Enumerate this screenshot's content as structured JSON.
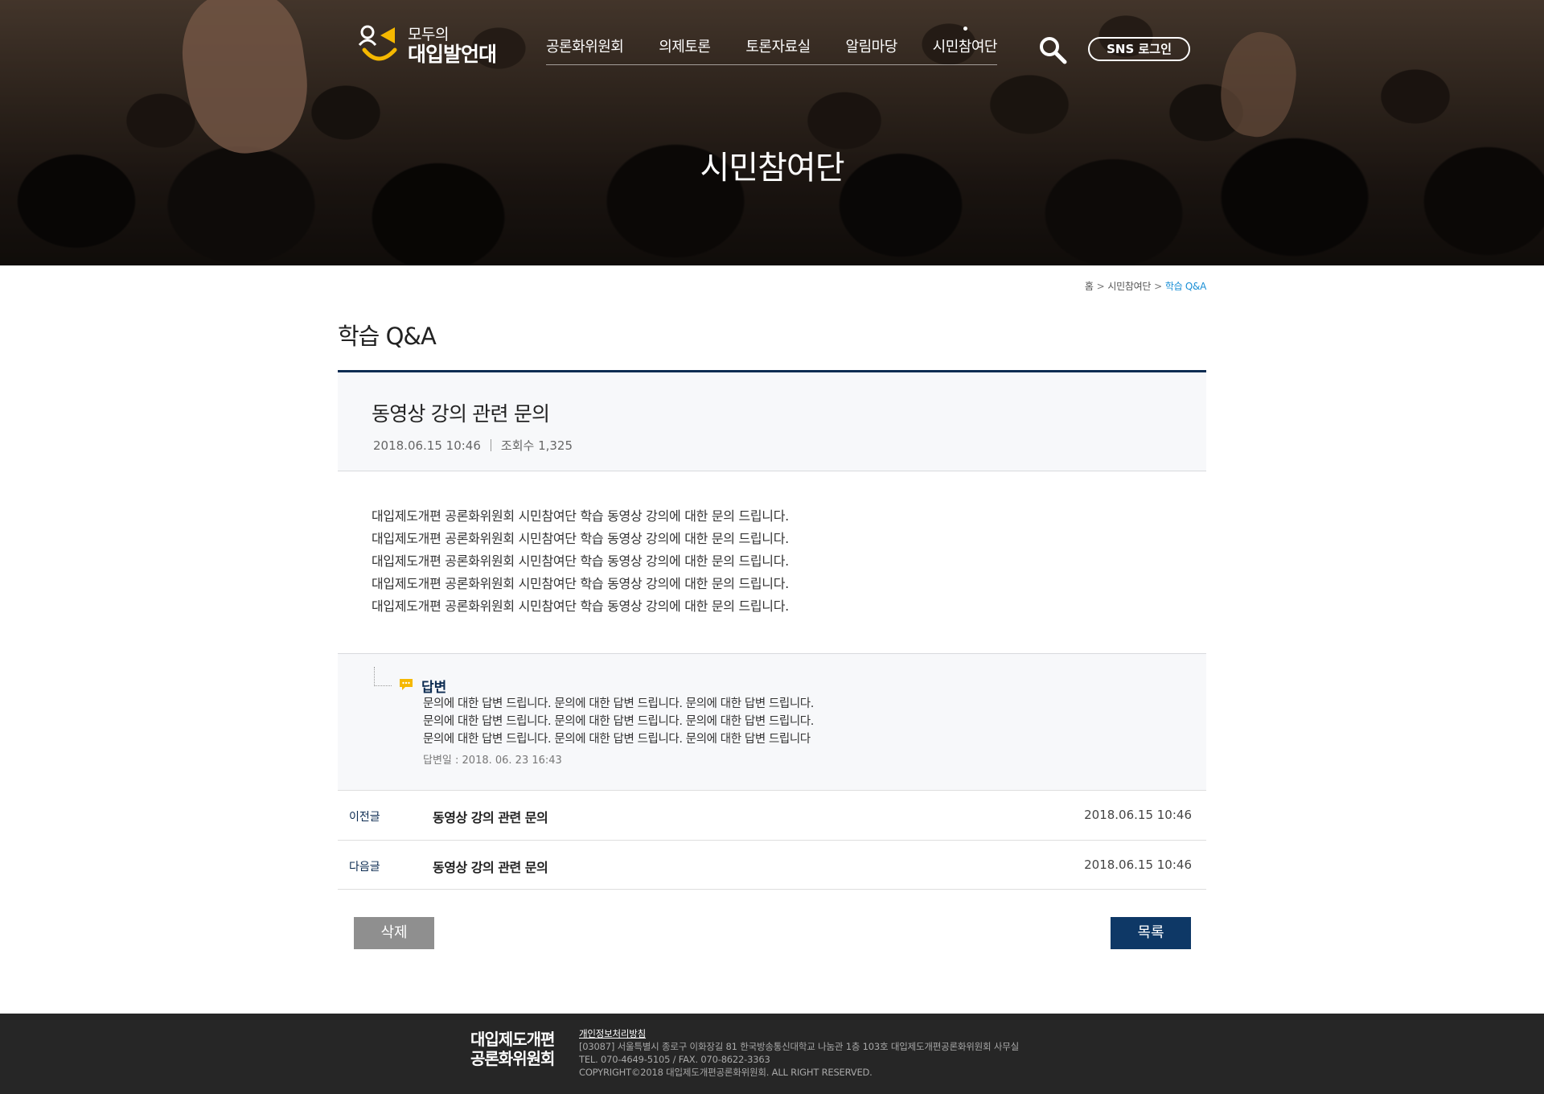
{
  "header": {
    "logo": {
      "line1": "모두의",
      "line2": "대입발언대"
    },
    "nav": [
      "공론화위원회",
      "의제토론",
      "토론자료실",
      "알림마당",
      "시민참여단"
    ],
    "sns_login": "SNS 로그인",
    "hero_title": "시민참여단"
  },
  "breadcrumb": {
    "home": "홈",
    "section": "시민참여단",
    "current": "학습 Q&A",
    "sep": ">"
  },
  "page_title": "학습 Q&A",
  "post": {
    "title": "동영상 강의 관련 문의",
    "date": "2018.06.15  10:46",
    "views_label": "조회수",
    "views": "1,325",
    "body": [
      "대입제도개편 공론화위원회 시민참여단 학습 동영상 강의에 대한 문의 드립니다.",
      "대입제도개편 공론화위원회 시민참여단 학습 동영상 강의에 대한 문의 드립니다.",
      "대입제도개편 공론화위원회 시민참여단 학습 동영상 강의에 대한 문의 드립니다.",
      "대입제도개편 공론화위원회 시민참여단 학습 동영상 강의에 대한 문의 드립니다.",
      "대입제도개편 공론화위원회 시민참여단 학습 동영상 강의에 대한 문의 드립니다."
    ]
  },
  "answer": {
    "label": "답변",
    "lines": [
      "문의에 대한 답변 드립니다. 문의에 대한 답변 드립니다. 문의에 대한 답변 드립니다.",
      "문의에 대한 답변 드립니다. 문의에 대한 답변 드립니다. 문의에 대한 답변 드립니다.",
      "문의에 대한 답변 드립니다. 문의에 대한 답변 드립니다. 문의에 대한 답변 드립니다"
    ],
    "date": "답변일 : 2018. 06. 23  16:43"
  },
  "prev": {
    "key": "이전글",
    "title": "동영상 강의 관련 문의",
    "date": "2018.06.15  10:46"
  },
  "next": {
    "key": "다음글",
    "title": "동영상 강의 관련 문의",
    "date": "2018.06.15  10:46"
  },
  "buttons": {
    "delete": "삭제",
    "list": "목록"
  },
  "footer": {
    "logo_line1": "대입제도개편",
    "logo_line2": "공론화위원회",
    "privacy": "개인정보처리방침",
    "address": "[03087] 서울특별시 종로구 이화장길 81 한국방송통신대학교 나눔관 1층 103호 대입제도개편공론화위원회 사무실",
    "contact": "TEL. 070-4649-5105 / FAX. 070-8622-3363",
    "copyright": "COPYRIGHT©2018 대입제도개편공론화위원회. ALL RIGHT RESERVED."
  },
  "colors": {
    "navy": "#0e3866",
    "accent_blue": "#1a8fd6",
    "logo_yellow": "#f5b800",
    "footer_bg": "#262626"
  },
  "icons": [
    "search-icon",
    "answer-chat-icon",
    "logo-mark"
  ]
}
